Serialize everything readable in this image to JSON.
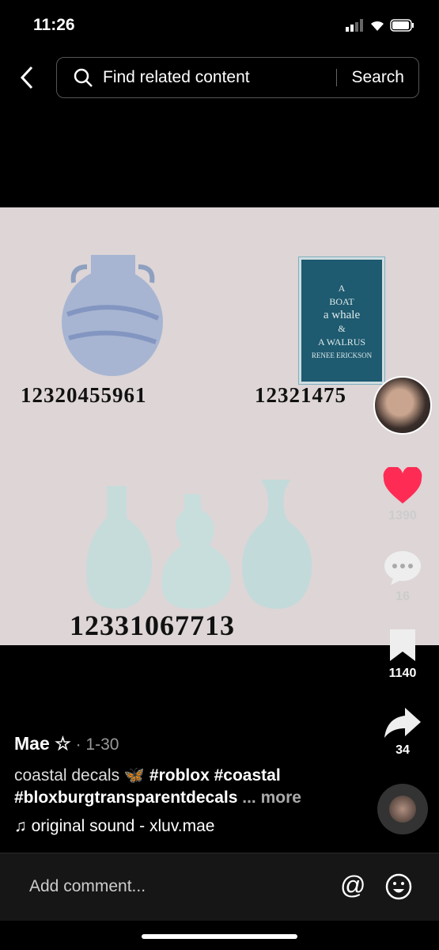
{
  "status": {
    "time": "11:26"
  },
  "search": {
    "placeholder": "Find related content",
    "button": "Search"
  },
  "media": {
    "codes": [
      "12320455961",
      "12321475",
      "12331067713"
    ],
    "book": {
      "line1": "A",
      "line2": "BOAT",
      "line3": "a whale",
      "line4": "&",
      "line5": "A WALRUS",
      "author": "RENEE ERICKSON"
    }
  },
  "rail": {
    "likes": "1390",
    "comments": "16",
    "saves": "1140",
    "shares": "34",
    "like_color": "#fe2c55"
  },
  "post": {
    "author": "Mae ☆",
    "date": "· 1-30",
    "caption_text": "coastal decals",
    "emoji": "🦋",
    "tags": "#roblox #coastal",
    "tags2": "#bloxburgtransparentdecals",
    "more": "... more",
    "sound": "original sound - xluv.mae"
  },
  "comment": {
    "placeholder": "Add comment..."
  }
}
